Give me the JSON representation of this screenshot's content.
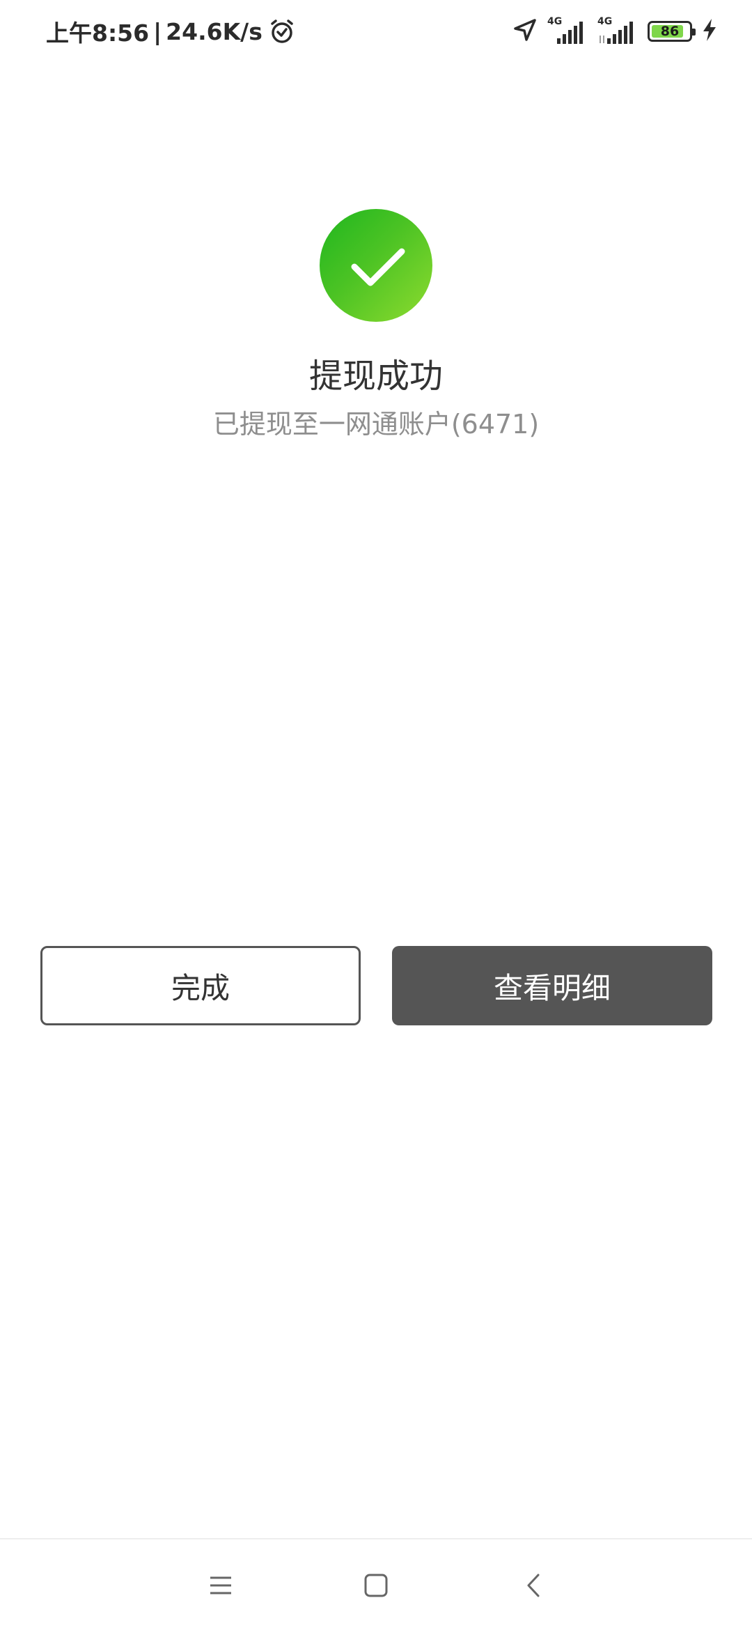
{
  "status_bar": {
    "time": "上午8:56",
    "separator": "|",
    "speed": "24.6K/s",
    "icons": [
      "alarm-icon",
      "location-icon",
      "signal-icon",
      "signal-icon",
      "battery-icon",
      "charging-icon"
    ],
    "sim1_network": "4G",
    "sim2_network": "4G",
    "battery_level": "86",
    "battery_fraction": 0.86,
    "battery_fill_color": "#7fd64a"
  },
  "result": {
    "icon": "check-icon",
    "icon_color": "#1fb61f",
    "title": "提现成功",
    "subtitle": "已提现至一网通账户(6471)"
  },
  "actions": {
    "done_label": "完成",
    "detail_label": "查看明细",
    "detail_bg_color": "#555555"
  },
  "nav_bar": {
    "icons": [
      "menu-icon",
      "home-icon",
      "back-icon"
    ]
  }
}
